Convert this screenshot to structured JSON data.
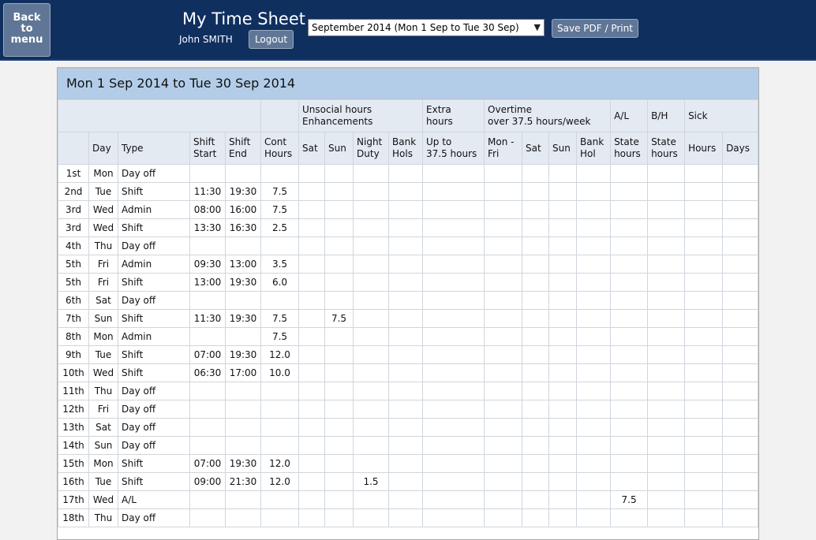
{
  "header": {
    "back_label_1": "Back",
    "back_label_2": "to",
    "back_label_3": "menu",
    "title": "My Time Sheet",
    "user_name": "John SMITH",
    "logout_label": "Logout",
    "period_selected": "September 2014 (Mon 1 Sep to Tue 30 Sep)",
    "save_label": "Save PDF / Print"
  },
  "panel": {
    "title": "Mon 1 Sep 2014 to Tue 30 Sep 2014"
  },
  "groups": {
    "unsocial_1": "Unsocial hours",
    "unsocial_2": "Enhancements",
    "extra_1": "Extra",
    "extra_2": "hours",
    "overtime_1": "Overtime",
    "overtime_2": "over 37.5 hours/week",
    "al": "A/L",
    "bh": "B/H",
    "sick": "Sick"
  },
  "columns": {
    "day": "Day",
    "type": "Type",
    "shift_start_1": "Shift",
    "shift_start_2": "Start",
    "shift_end_1": "Shift",
    "shift_end_2": "End",
    "cont_1": "Cont",
    "cont_2": "Hours",
    "sat": "Sat",
    "sun": "Sun",
    "night_1": "Night",
    "night_2": "Duty",
    "bank_1": "Bank",
    "bank_2": "Hols",
    "upto_1": "Up to",
    "upto_2": "37.5 hours",
    "monfri_1": "Mon -",
    "monfri_2": "Fri",
    "ot_sat": "Sat",
    "ot_sun": "Sun",
    "banhol_1": "Bank",
    "banhol_2": "Hol",
    "al_1": "State",
    "al_2": "hours",
    "bh_1": "State",
    "bh_2": "hours",
    "sick_hours": "Hours",
    "sick_days": "Days"
  },
  "rows": [
    {
      "date": "1st",
      "day": "Mon",
      "type": "Day off",
      "start": "",
      "end": "",
      "cont": "",
      "sat": "",
      "sun": "",
      "night": "",
      "bank": "",
      "upto": "",
      "monfri": "",
      "otsat": "",
      "otsun": "",
      "bankhol": "",
      "al": "",
      "bh": "",
      "sickh": "",
      "sickd": ""
    },
    {
      "date": "2nd",
      "day": "Tue",
      "type": "Shift",
      "start": "11:30",
      "end": "19:30",
      "cont": "7.5",
      "sat": "",
      "sun": "",
      "night": "",
      "bank": "",
      "upto": "",
      "monfri": "",
      "otsat": "",
      "otsun": "",
      "bankhol": "",
      "al": "",
      "bh": "",
      "sickh": "",
      "sickd": ""
    },
    {
      "date": "3rd",
      "day": "Wed",
      "type": "Admin",
      "start": "08:00",
      "end": "16:00",
      "cont": "7.5",
      "sat": "",
      "sun": "",
      "night": "",
      "bank": "",
      "upto": "",
      "monfri": "",
      "otsat": "",
      "otsun": "",
      "bankhol": "",
      "al": "",
      "bh": "",
      "sickh": "",
      "sickd": ""
    },
    {
      "date": "3rd",
      "day": "Wed",
      "type": "Shift",
      "start": "13:30",
      "end": "16:30",
      "cont": "2.5",
      "sat": "",
      "sun": "",
      "night": "",
      "bank": "",
      "upto": "",
      "monfri": "",
      "otsat": "",
      "otsun": "",
      "bankhol": "",
      "al": "",
      "bh": "",
      "sickh": "",
      "sickd": ""
    },
    {
      "date": "4th",
      "day": "Thu",
      "type": "Day off",
      "start": "",
      "end": "",
      "cont": "",
      "sat": "",
      "sun": "",
      "night": "",
      "bank": "",
      "upto": "",
      "monfri": "",
      "otsat": "",
      "otsun": "",
      "bankhol": "",
      "al": "",
      "bh": "",
      "sickh": "",
      "sickd": ""
    },
    {
      "date": "5th",
      "day": "Fri",
      "type": "Admin",
      "start": "09:30",
      "end": "13:00",
      "cont": "3.5",
      "sat": "",
      "sun": "",
      "night": "",
      "bank": "",
      "upto": "",
      "monfri": "",
      "otsat": "",
      "otsun": "",
      "bankhol": "",
      "al": "",
      "bh": "",
      "sickh": "",
      "sickd": ""
    },
    {
      "date": "5th",
      "day": "Fri",
      "type": "Shift",
      "start": "13:00",
      "end": "19:30",
      "cont": "6.0",
      "sat": "",
      "sun": "",
      "night": "",
      "bank": "",
      "upto": "",
      "monfri": "",
      "otsat": "",
      "otsun": "",
      "bankhol": "",
      "al": "",
      "bh": "",
      "sickh": "",
      "sickd": ""
    },
    {
      "date": "6th",
      "day": "Sat",
      "type": "Day off",
      "start": "",
      "end": "",
      "cont": "",
      "sat": "",
      "sun": "",
      "night": "",
      "bank": "",
      "upto": "",
      "monfri": "",
      "otsat": "",
      "otsun": "",
      "bankhol": "",
      "al": "",
      "bh": "",
      "sickh": "",
      "sickd": ""
    },
    {
      "date": "7th",
      "day": "Sun",
      "type": "Shift",
      "start": "11:30",
      "end": "19:30",
      "cont": "7.5",
      "sat": "",
      "sun": "7.5",
      "night": "",
      "bank": "",
      "upto": "",
      "monfri": "",
      "otsat": "",
      "otsun": "",
      "bankhol": "",
      "al": "",
      "bh": "",
      "sickh": "",
      "sickd": ""
    },
    {
      "date": "8th",
      "day": "Mon",
      "type": "Admin",
      "start": "",
      "end": "",
      "cont": "7.5",
      "sat": "",
      "sun": "",
      "night": "",
      "bank": "",
      "upto": "",
      "monfri": "",
      "otsat": "",
      "otsun": "",
      "bankhol": "",
      "al": "",
      "bh": "",
      "sickh": "",
      "sickd": ""
    },
    {
      "date": "9th",
      "day": "Tue",
      "type": "Shift",
      "start": "07:00",
      "end": "19:30",
      "cont": "12.0",
      "sat": "",
      "sun": "",
      "night": "",
      "bank": "",
      "upto": "",
      "monfri": "",
      "otsat": "",
      "otsun": "",
      "bankhol": "",
      "al": "",
      "bh": "",
      "sickh": "",
      "sickd": ""
    },
    {
      "date": "10th",
      "day": "Wed",
      "type": "Shift",
      "start": "06:30",
      "end": "17:00",
      "cont": "10.0",
      "sat": "",
      "sun": "",
      "night": "",
      "bank": "",
      "upto": "",
      "monfri": "",
      "otsat": "",
      "otsun": "",
      "bankhol": "",
      "al": "",
      "bh": "",
      "sickh": "",
      "sickd": ""
    },
    {
      "date": "11th",
      "day": "Thu",
      "type": "Day off",
      "start": "",
      "end": "",
      "cont": "",
      "sat": "",
      "sun": "",
      "night": "",
      "bank": "",
      "upto": "",
      "monfri": "",
      "otsat": "",
      "otsun": "",
      "bankhol": "",
      "al": "",
      "bh": "",
      "sickh": "",
      "sickd": ""
    },
    {
      "date": "12th",
      "day": "Fri",
      "type": "Day off",
      "start": "",
      "end": "",
      "cont": "",
      "sat": "",
      "sun": "",
      "night": "",
      "bank": "",
      "upto": "",
      "monfri": "",
      "otsat": "",
      "otsun": "",
      "bankhol": "",
      "al": "",
      "bh": "",
      "sickh": "",
      "sickd": ""
    },
    {
      "date": "13th",
      "day": "Sat",
      "type": "Day off",
      "start": "",
      "end": "",
      "cont": "",
      "sat": "",
      "sun": "",
      "night": "",
      "bank": "",
      "upto": "",
      "monfri": "",
      "otsat": "",
      "otsun": "",
      "bankhol": "",
      "al": "",
      "bh": "",
      "sickh": "",
      "sickd": ""
    },
    {
      "date": "14th",
      "day": "Sun",
      "type": "Day off",
      "start": "",
      "end": "",
      "cont": "",
      "sat": "",
      "sun": "",
      "night": "",
      "bank": "",
      "upto": "",
      "monfri": "",
      "otsat": "",
      "otsun": "",
      "bankhol": "",
      "al": "",
      "bh": "",
      "sickh": "",
      "sickd": ""
    },
    {
      "date": "15th",
      "day": "Mon",
      "type": "Shift",
      "start": "07:00",
      "end": "19:30",
      "cont": "12.0",
      "sat": "",
      "sun": "",
      "night": "",
      "bank": "",
      "upto": "",
      "monfri": "",
      "otsat": "",
      "otsun": "",
      "bankhol": "",
      "al": "",
      "bh": "",
      "sickh": "",
      "sickd": ""
    },
    {
      "date": "16th",
      "day": "Tue",
      "type": "Shift",
      "start": "09:00",
      "end": "21:30",
      "cont": "12.0",
      "sat": "",
      "sun": "",
      "night": "1.5",
      "bank": "",
      "upto": "",
      "monfri": "",
      "otsat": "",
      "otsun": "",
      "bankhol": "",
      "al": "",
      "bh": "",
      "sickh": "",
      "sickd": ""
    },
    {
      "date": "17th",
      "day": "Wed",
      "type": "A/L",
      "start": "",
      "end": "",
      "cont": "",
      "sat": "",
      "sun": "",
      "night": "",
      "bank": "",
      "upto": "",
      "monfri": "",
      "otsat": "",
      "otsun": "",
      "bankhol": "",
      "al": "7.5",
      "bh": "",
      "sickh": "",
      "sickd": ""
    },
    {
      "date": "18th",
      "day": "Thu",
      "type": "Day off",
      "start": "",
      "end": "",
      "cont": "",
      "sat": "",
      "sun": "",
      "night": "",
      "bank": "",
      "upto": "",
      "monfri": "",
      "otsat": "",
      "otsun": "",
      "bankhol": "",
      "al": "",
      "bh": "",
      "sickh": "",
      "sickd": ""
    }
  ]
}
